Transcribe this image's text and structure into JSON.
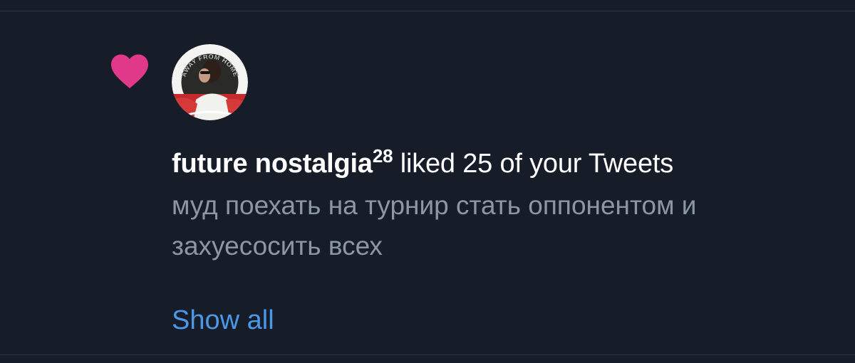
{
  "notification": {
    "type_icon": "heart-icon",
    "accent_color": "#e0398a",
    "avatar": {
      "ring_text": "AWAY FROM HOME"
    },
    "user_name": "future nostalgia",
    "user_name_suffix": "28",
    "action_text": " liked 25 of your Tweets",
    "tweet_text": "муд поехать на турнир стать оппонентом и захуесосить всех",
    "show_all_label": "Show all",
    "link_color": "#4a99e9"
  }
}
